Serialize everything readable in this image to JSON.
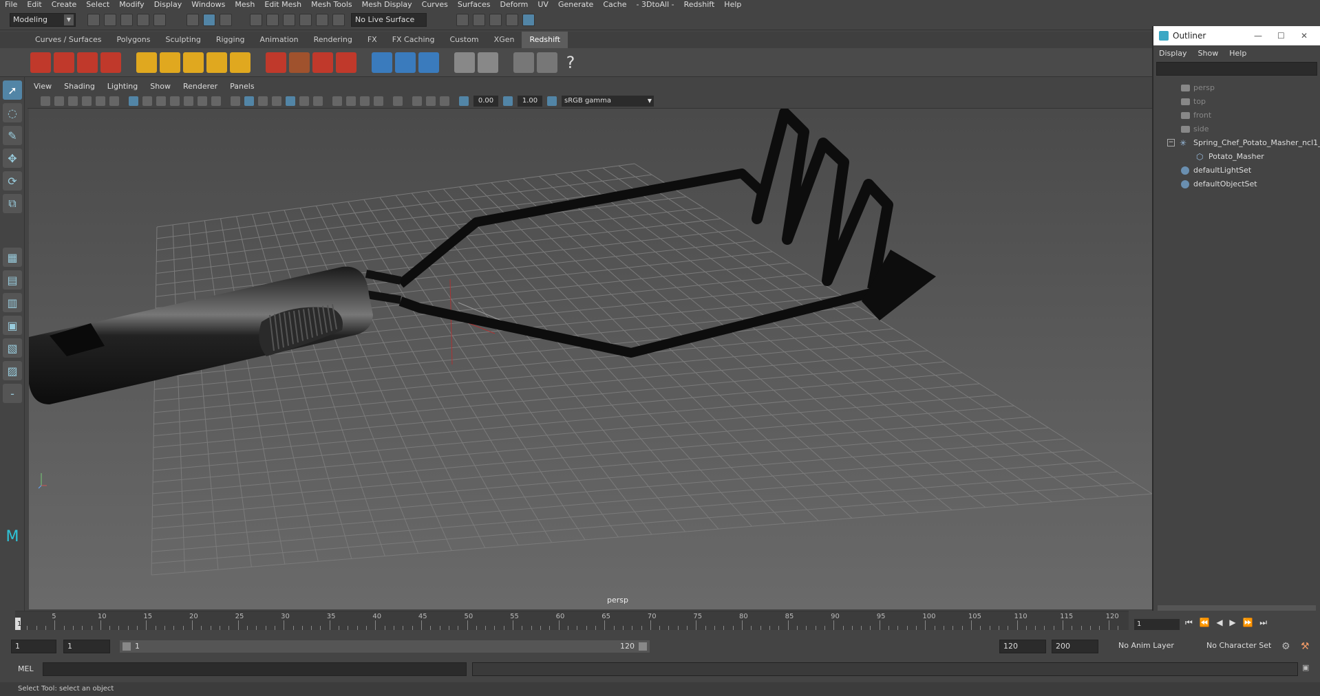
{
  "menubar": [
    "File",
    "Edit",
    "Create",
    "Select",
    "Modify",
    "Display",
    "Windows",
    "Mesh",
    "Edit Mesh",
    "Mesh Tools",
    "Mesh Display",
    "Curves",
    "Surfaces",
    "Deform",
    "UV",
    "Generate",
    "Cache",
    "- 3DtoAll -",
    "Redshift",
    "Help"
  ],
  "status": {
    "mode": "Modeling",
    "live_surface": "No Live Surface"
  },
  "shelf_tabs": [
    "Curves / Surfaces",
    "Polygons",
    "Sculpting",
    "Rigging",
    "Animation",
    "Rendering",
    "FX",
    "FX Caching",
    "Custom",
    "XGen",
    "Redshift"
  ],
  "shelf_active_tab": "Redshift",
  "panel_menu": [
    "View",
    "Shading",
    "Lighting",
    "Show",
    "Renderer",
    "Panels"
  ],
  "panel_tools": {
    "exposure": "0.00",
    "gamma": "1.00",
    "color_space": "sRGB gamma"
  },
  "viewport": {
    "camera": "persp"
  },
  "outliner": {
    "title": "Outliner",
    "menu": [
      "Display",
      "Show",
      "Help"
    ],
    "items": [
      {
        "label": "persp",
        "type": "camera"
      },
      {
        "label": "top",
        "type": "camera"
      },
      {
        "label": "front",
        "type": "camera"
      },
      {
        "label": "side",
        "type": "camera"
      },
      {
        "label": "Spring_Chef_Potato_Masher_ncl1_",
        "type": "group"
      },
      {
        "label": "Potato_Masher",
        "type": "mesh"
      },
      {
        "label": "defaultLightSet",
        "type": "set"
      },
      {
        "label": "defaultObjectSet",
        "type": "set"
      }
    ]
  },
  "timeline": {
    "ticks": [
      "5",
      "10",
      "15",
      "20",
      "25",
      "30",
      "35",
      "40",
      "45",
      "50",
      "55",
      "60",
      "65",
      "70",
      "75",
      "80",
      "85",
      "90",
      "95",
      "100",
      "105",
      "110",
      "115",
      "120"
    ],
    "current_frame": "1",
    "frame_field": "1"
  },
  "range": {
    "start": "1",
    "start2": "1",
    "slider_start": "1",
    "slider_end": "120",
    "end": "120",
    "end2": "200",
    "anim_layer": "No Anim Layer",
    "char_set": "No Character Set"
  },
  "cmdline": {
    "label": "MEL"
  },
  "helpline": "Select Tool: select an object",
  "colors": {
    "accent": "#5285a6",
    "viewport": "#5a5a5a",
    "model": "#111111"
  }
}
